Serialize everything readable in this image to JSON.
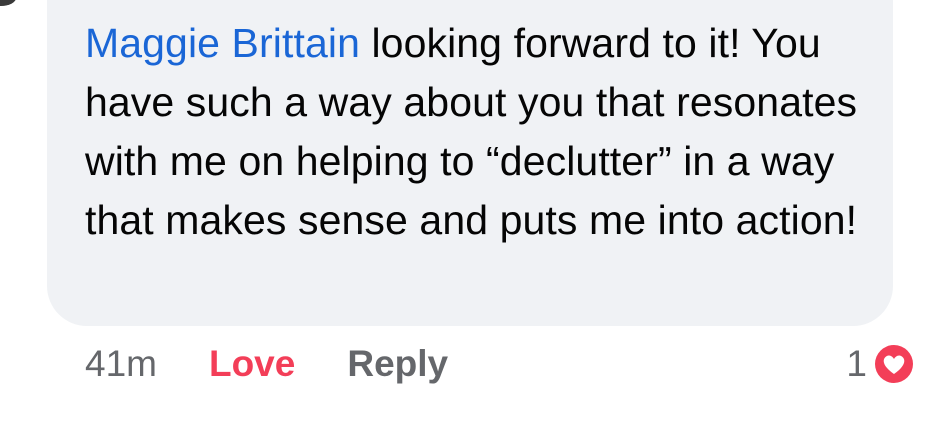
{
  "comment": {
    "author": "Maggie Brittain",
    "text": " looking forward to it! You have such a way about you that resonates with me on helping to “declutter” in a way that makes sense and puts me into action!"
  },
  "actions": {
    "timestamp": "41m",
    "love_label": "Love",
    "reply_label": "Reply"
  },
  "reaction": {
    "count": "1",
    "icon": "love-reaction-icon"
  },
  "colors": {
    "bubble": "#f0f2f5",
    "author_link": "#1a66d6",
    "love": "#f33e58",
    "muted": "#65676b"
  }
}
